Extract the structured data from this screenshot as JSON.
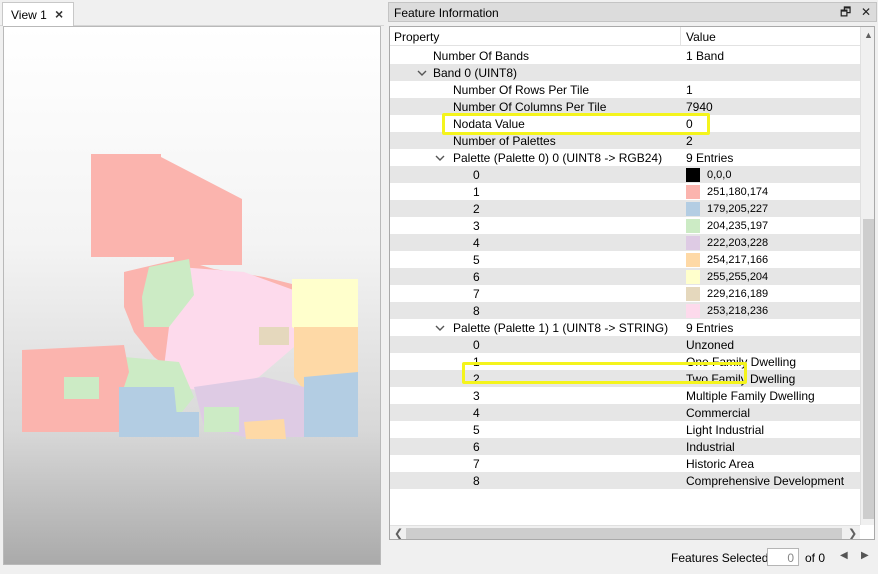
{
  "view_tab": {
    "label": "View 1",
    "close": "×"
  },
  "panel": {
    "title": "Feature Information",
    "restore_icon": "restore-icon",
    "close_icon": "close-icon",
    "columns": {
      "property": "Property",
      "value": "Value"
    }
  },
  "rows": [
    {
      "name": "Number Of Bands",
      "value": "1 Band"
    },
    {
      "name": "Band 0 (UINT8)",
      "value": ""
    },
    {
      "name": "Number Of Rows Per Tile",
      "value": "1"
    },
    {
      "name": "Number Of Columns Per Tile",
      "value": "7940"
    },
    {
      "name": "Nodata Value",
      "value": "0"
    },
    {
      "name": "Number of Palettes",
      "value": "2"
    },
    {
      "name": "Palette (Palette 0) 0 (UINT8 -> RGB24)",
      "value": "9 Entries"
    },
    {
      "name": "0",
      "value": "0,0,0",
      "color": "#000000"
    },
    {
      "name": "1",
      "value": "251,180,174",
      "color": "#fbb4ae"
    },
    {
      "name": "2",
      "value": "179,205,227",
      "color": "#b3cde3"
    },
    {
      "name": "3",
      "value": "204,235,197",
      "color": "#ccebc5"
    },
    {
      "name": "4",
      "value": "222,203,228",
      "color": "#decbe4"
    },
    {
      "name": "5",
      "value": "254,217,166",
      "color": "#fed9a6"
    },
    {
      "name": "6",
      "value": "255,255,204",
      "color": "#ffffcc"
    },
    {
      "name": "7",
      "value": "229,216,189",
      "color": "#e5d8bd"
    },
    {
      "name": "8",
      "value": "253,218,236",
      "color": "#fddaec"
    },
    {
      "name": "Palette (Palette 1) 1 (UINT8 -> STRING)",
      "value": "9 Entries"
    },
    {
      "name": "0",
      "value": "Unzoned"
    },
    {
      "name": "1",
      "value": "One Family Dwelling"
    },
    {
      "name": "2",
      "value": "Two Family Dwelling"
    },
    {
      "name": "3",
      "value": "Multiple Family Dwelling"
    },
    {
      "name": "4",
      "value": "Commercial"
    },
    {
      "name": "5",
      "value": "Light Industrial"
    },
    {
      "name": "6",
      "value": "Industrial"
    },
    {
      "name": "7",
      "value": "Historic Area"
    },
    {
      "name": "8",
      "value": "Comprehensive Development"
    }
  ],
  "footer": {
    "label": "Features Selected:",
    "count": "0",
    "of_text": "of 0"
  },
  "colors": {
    "highlight": "#f4f41c"
  }
}
